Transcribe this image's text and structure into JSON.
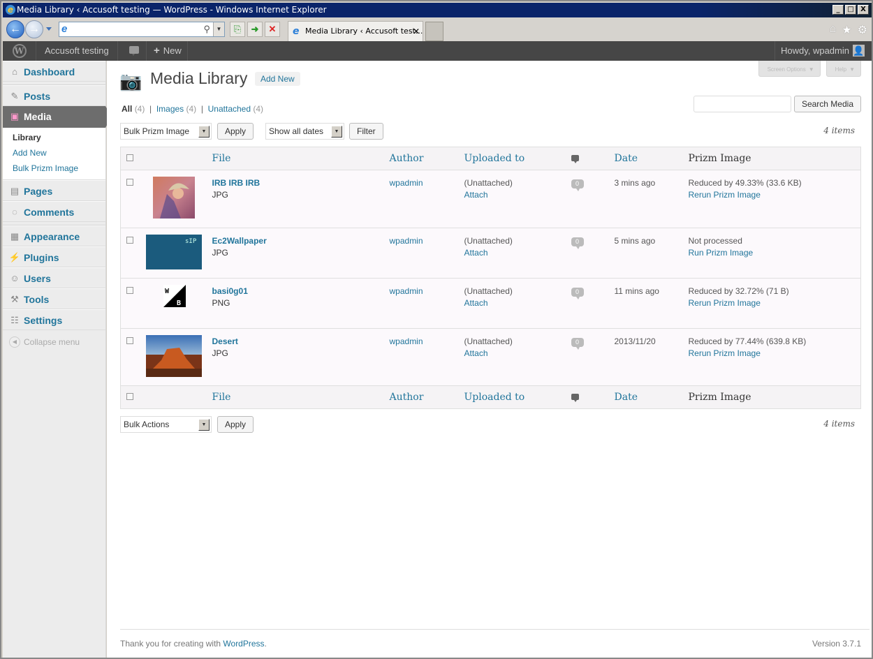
{
  "window": {
    "title": "Media Library ‹ Accusoft testing — WordPress - Windows Internet Explorer",
    "controls": [
      "_",
      "□",
      "X"
    ]
  },
  "browser": {
    "address_value": "",
    "tab_title": "Media Library ‹ Accusoft test...",
    "tab_close": "✕"
  },
  "adminbar": {
    "site_name": "Accusoft testing",
    "new_label": "New",
    "howdy": "Howdy, wpadmin"
  },
  "sidebar": {
    "items": [
      {
        "label": "Dashboard",
        "icon": "dashboard-icon"
      },
      {
        "label": "Posts",
        "icon": "pin-icon"
      },
      {
        "label": "Media",
        "icon": "media-icon",
        "current": true
      },
      {
        "label": "Pages",
        "icon": "pages-icon"
      },
      {
        "label": "Comments",
        "icon": "comment-icon"
      },
      {
        "label": "Appearance",
        "icon": "appearance-icon"
      },
      {
        "label": "Plugins",
        "icon": "plugin-icon"
      },
      {
        "label": "Users",
        "icon": "users-icon"
      },
      {
        "label": "Tools",
        "icon": "tools-icon"
      },
      {
        "label": "Settings",
        "icon": "settings-icon"
      }
    ],
    "submenu": [
      "Library",
      "Add New",
      "Bulk Prizm Image"
    ],
    "collapse": "Collapse menu"
  },
  "screen_meta": {
    "screen_options": "Screen Options",
    "help": "Help"
  },
  "page": {
    "title": "Media Library",
    "add_new": "Add New",
    "filters": [
      {
        "label": "All",
        "count": "(4)"
      },
      {
        "label": "Images",
        "count": "(4)"
      },
      {
        "label": "Unattached",
        "count": "(4)"
      }
    ],
    "search_value": "",
    "search_button": "Search Media",
    "top_bulk_select": "Bulk Prizm Image",
    "apply": "Apply",
    "date_select": "Show all dates",
    "filter": "Filter",
    "bottom_bulk_select": "Bulk Actions",
    "items_count": "4 items"
  },
  "table": {
    "headers": {
      "file": "File",
      "author": "Author",
      "uploaded": "Uploaded to",
      "date": "Date",
      "prizm": "Prizm Image"
    },
    "rows": [
      {
        "title": "IRB IRB IRB",
        "format": "JPG",
        "author": "wpadmin",
        "uploaded": "(Unattached)",
        "attach": "Attach",
        "comments": "0",
        "date": "3 mins ago",
        "prizm_status": "Reduced by 49.33% (33.6 KB)",
        "prizm_action": "Rerun Prizm Image"
      },
      {
        "title": "Ec2Wallpaper",
        "format": "JPG",
        "author": "wpadmin",
        "uploaded": "(Unattached)",
        "attach": "Attach",
        "comments": "0",
        "date": "5 mins ago",
        "prizm_status": "Not processed",
        "prizm_action": "Run Prizm Image"
      },
      {
        "title": "basi0g01",
        "format": "PNG",
        "author": "wpadmin",
        "uploaded": "(Unattached)",
        "attach": "Attach",
        "comments": "0",
        "date": "11 mins ago",
        "prizm_status": "Reduced by 32.72% (71 B)",
        "prizm_action": "Rerun Prizm Image"
      },
      {
        "title": "Desert",
        "format": "JPG",
        "author": "wpadmin",
        "uploaded": "(Unattached)",
        "attach": "Attach",
        "comments": "0",
        "date": "2013/11/20",
        "prizm_status": "Reduced by 77.44% (639.8 KB)",
        "prizm_action": "Rerun Prizm Image"
      }
    ]
  },
  "footer": {
    "thanks": "Thank you for creating with ",
    "wp_link": "WordPress",
    "period": ".",
    "version": "Version 3.7.1"
  }
}
